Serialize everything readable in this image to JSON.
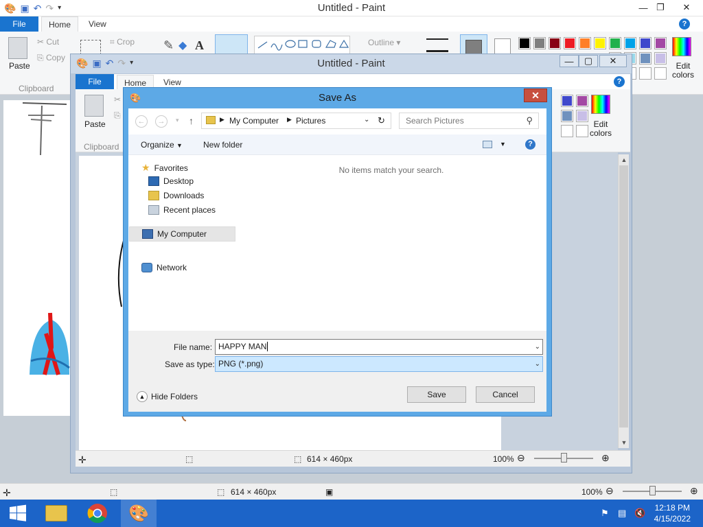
{
  "back_window": {
    "title": "Untitled - Paint",
    "file_tab": "File",
    "tabs": [
      "Home",
      "View"
    ],
    "clipboard": {
      "paste": "Paste",
      "cut": "Cut",
      "copy": "Copy",
      "group": "Clipboard"
    },
    "image": {
      "crop": "Crop"
    },
    "shapes": {
      "outline": "Outline"
    },
    "edit_colors": [
      "Edit",
      "colors"
    ],
    "palette": [
      "#000000",
      "#7f7f7f",
      "#880015",
      "#ed1c24",
      "#ff7f27",
      "#fff200",
      "#22b14c",
      "#00a2e8",
      "#3f48cc",
      "#a349a4"
    ],
    "palette_row2": [
      "#b5e61d",
      "#99d9ea",
      "#7092be",
      "#c8bfe7"
    ],
    "status": {
      "size": "614 × 460px",
      "zoom": "100%"
    }
  },
  "front_window": {
    "title": "Untitled - Paint",
    "file_tab": "File",
    "tabs": [
      "Home",
      "View"
    ],
    "clipboard": {
      "paste": "Paste",
      "group": "Clipboard"
    },
    "edit_colors": [
      "Edit",
      "colors"
    ],
    "status": {
      "size": "614 × 460px",
      "zoom": "100%"
    }
  },
  "dialog": {
    "title": "Save As",
    "breadcrumb": [
      "My Computer",
      "Pictures"
    ],
    "search_placeholder": "Search Pictures",
    "organize": "Organize",
    "new_folder": "New folder",
    "nav": {
      "favorites": "Favorites",
      "items": [
        "Desktop",
        "Downloads",
        "Recent places"
      ],
      "computer": "My Computer",
      "network": "Network"
    },
    "empty_message": "No items match your search.",
    "file_name_label": "File name:",
    "file_name_value": "HAPPY MAN",
    "save_type_label": "Save as type:",
    "save_type_value": "PNG (*.png)",
    "hide_folders": "Hide Folders",
    "save": "Save",
    "cancel": "Cancel"
  },
  "taskbar": {
    "time": "12:18 PM",
    "date": "4/15/2022"
  }
}
